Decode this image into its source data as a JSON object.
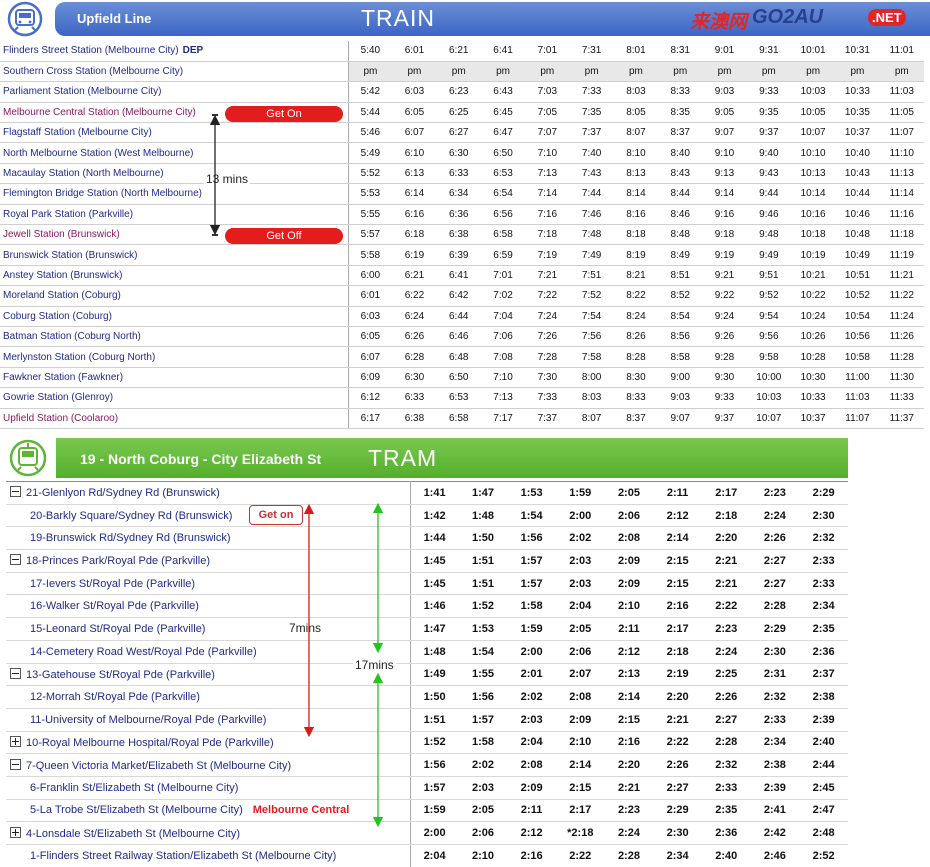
{
  "train": {
    "line_title": "Upfield Line",
    "mode_label": "TRAIN",
    "dep_label": "DEP",
    "times": [
      [
        "5:40",
        "6:01",
        "6:21",
        "6:41",
        "7:01",
        "7:31",
        "8:01",
        "8:31",
        "9:01",
        "9:31",
        "10:01",
        "10:31",
        "11:01"
      ],
      [
        "pm",
        "pm",
        "pm",
        "pm",
        "pm",
        "pm",
        "pm",
        "pm",
        "pm",
        "pm",
        "pm",
        "pm",
        "pm"
      ],
      [
        "5:42",
        "6:03",
        "6:23",
        "6:43",
        "7:03",
        "7:33",
        "8:03",
        "8:33",
        "9:03",
        "9:33",
        "10:03",
        "10:33",
        "11:03"
      ],
      [
        "5:44",
        "6:05",
        "6:25",
        "6:45",
        "7:05",
        "7:35",
        "8:05",
        "8:35",
        "9:05",
        "9:35",
        "10:05",
        "10:35",
        "11:05"
      ],
      [
        "5:46",
        "6:07",
        "6:27",
        "6:47",
        "7:07",
        "7:37",
        "8:07",
        "8:37",
        "9:07",
        "9:37",
        "10:07",
        "10:37",
        "11:07"
      ],
      [
        "5:49",
        "6:10",
        "6:30",
        "6:50",
        "7:10",
        "7:40",
        "8:10",
        "8:40",
        "9:10",
        "9:40",
        "10:10",
        "10:40",
        "11:10"
      ],
      [
        "5:52",
        "6:13",
        "6:33",
        "6:53",
        "7:13",
        "7:43",
        "8:13",
        "8:43",
        "9:13",
        "9:43",
        "10:13",
        "10:43",
        "11:13"
      ],
      [
        "5:53",
        "6:14",
        "6:34",
        "6:54",
        "7:14",
        "7:44",
        "8:14",
        "8:44",
        "9:14",
        "9:44",
        "10:14",
        "10:44",
        "11:14"
      ],
      [
        "5:55",
        "6:16",
        "6:36",
        "6:56",
        "7:16",
        "7:46",
        "8:16",
        "8:46",
        "9:16",
        "9:46",
        "10:16",
        "10:46",
        "11:16"
      ],
      [
        "5:57",
        "6:18",
        "6:38",
        "6:58",
        "7:18",
        "7:48",
        "8:18",
        "8:48",
        "9:18",
        "9:48",
        "10:18",
        "10:48",
        "11:18"
      ],
      [
        "5:58",
        "6:19",
        "6:39",
        "6:59",
        "7:19",
        "7:49",
        "8:19",
        "8:49",
        "9:19",
        "9:49",
        "10:19",
        "10:49",
        "11:19"
      ],
      [
        "6:00",
        "6:21",
        "6:41",
        "7:01",
        "7:21",
        "7:51",
        "8:21",
        "8:51",
        "9:21",
        "9:51",
        "10:21",
        "10:51",
        "11:21"
      ],
      [
        "6:01",
        "6:22",
        "6:42",
        "7:02",
        "7:22",
        "7:52",
        "8:22",
        "8:52",
        "9:22",
        "9:52",
        "10:22",
        "10:52",
        "11:22"
      ],
      [
        "6:03",
        "6:24",
        "6:44",
        "7:04",
        "7:24",
        "7:54",
        "8:24",
        "8:54",
        "9:24",
        "9:54",
        "10:24",
        "10:54",
        "11:24"
      ],
      [
        "6:05",
        "6:26",
        "6:46",
        "7:06",
        "7:26",
        "7:56",
        "8:26",
        "8:56",
        "9:26",
        "9:56",
        "10:26",
        "10:56",
        "11:26"
      ],
      [
        "6:07",
        "6:28",
        "6:48",
        "7:08",
        "7:28",
        "7:58",
        "8:28",
        "8:58",
        "9:28",
        "9:58",
        "10:28",
        "10:58",
        "11:28"
      ],
      [
        "6:09",
        "6:30",
        "6:50",
        "7:10",
        "7:30",
        "8:00",
        "8:30",
        "9:00",
        "9:30",
        "10:00",
        "10:30",
        "11:00",
        "11:30"
      ],
      [
        "6:12",
        "6:33",
        "6:53",
        "7:13",
        "7:33",
        "8:03",
        "8:33",
        "9:03",
        "9:33",
        "10:03",
        "10:33",
        "11:03",
        "11:33"
      ],
      [
        "6:17",
        "6:38",
        "6:58",
        "7:17",
        "7:37",
        "8:07",
        "8:37",
        "9:07",
        "9:37",
        "10:07",
        "10:37",
        "11:07",
        "11:37"
      ]
    ],
    "stations": [
      "Flinders Street Station (Melbourne City)",
      "Southern Cross Station (Melbourne City)",
      "Parliament Station (Melbourne City)",
      "Melbourne Central Station (Melbourne City)",
      "Flagstaff Station (Melbourne City)",
      "North Melbourne Station (West Melbourne)",
      "Macaulay Station (North Melbourne)",
      "Flemington Bridge Station (North Melbourne)",
      "Royal Park Station (Parkville)",
      "Jewell Station (Brunswick)",
      "Brunswick Station (Brunswick)",
      "Anstey Station (Brunswick)",
      "Moreland Station (Coburg)",
      "Coburg Station (Coburg)",
      "Batman Station (Coburg North)",
      "Merlynston Station (Coburg North)",
      "Fawkner Station (Fawkner)",
      "Gowrie Station (Glenroy)",
      "Upfield Station (Coolaroo)"
    ],
    "get_on_label": "Get On",
    "get_off_label": "Get Off",
    "duration_label": "13 mins"
  },
  "logo": {
    "cn": "来澳网",
    "en": "GO2AU",
    "net": ".NET"
  },
  "tram": {
    "route_title": "19 - North Coburg - City Elizabeth St",
    "mode_label": "TRAM",
    "stops": [
      "21-Glenlyon Rd/Sydney Rd (Brunswick)",
      "20-Barkly Square/Sydney Rd (Brunswick)",
      "19-Brunswick Rd/Sydney Rd (Brunswick)",
      "18-Princes Park/Royal Pde (Parkville)",
      "17-Ievers St/Royal Pde (Parkville)",
      "16-Walker St/Royal Pde (Parkville)",
      "15-Leonard St/Royal Pde (Parkville)",
      "14-Cemetery Road West/Royal Pde (Parkville)",
      "13-Gatehouse St/Royal Pde (Parkville)",
      "12-Morrah St/Royal Pde (Parkville)",
      "11-University of Melbourne/Royal Pde (Parkville)",
      "10-Royal Melbourne Hospital/Royal Pde (Parkville)",
      "7-Queen Victoria Market/Elizabeth St (Melbourne City)",
      "6-Franklin St/Elizabeth St (Melbourne City)",
      "5-La Trobe St/Elizabeth St (Melbourne City)",
      "4-Lonsdale St/Elizabeth St (Melbourne City)",
      "1-Flinders Street Railway Station/Elizabeth St (Melbourne City)"
    ],
    "times": [
      [
        "1:41",
        "1:47",
        "1:53",
        "1:59",
        "2:05",
        "2:11",
        "2:17",
        "2:23",
        "2:29"
      ],
      [
        "1:42",
        "1:48",
        "1:54",
        "2:00",
        "2:06",
        "2:12",
        "2:18",
        "2:24",
        "2:30"
      ],
      [
        "1:44",
        "1:50",
        "1:56",
        "2:02",
        "2:08",
        "2:14",
        "2:20",
        "2:26",
        "2:32"
      ],
      [
        "1:45",
        "1:51",
        "1:57",
        "2:03",
        "2:09",
        "2:15",
        "2:21",
        "2:27",
        "2:33"
      ],
      [
        "1:45",
        "1:51",
        "1:57",
        "2:03",
        "2:09",
        "2:15",
        "2:21",
        "2:27",
        "2:33"
      ],
      [
        "1:46",
        "1:52",
        "1:58",
        "2:04",
        "2:10",
        "2:16",
        "2:22",
        "2:28",
        "2:34"
      ],
      [
        "1:47",
        "1:53",
        "1:59",
        "2:05",
        "2:11",
        "2:17",
        "2:23",
        "2:29",
        "2:35"
      ],
      [
        "1:48",
        "1:54",
        "2:00",
        "2:06",
        "2:12",
        "2:18",
        "2:24",
        "2:30",
        "2:36"
      ],
      [
        "1:49",
        "1:55",
        "2:01",
        "2:07",
        "2:13",
        "2:19",
        "2:25",
        "2:31",
        "2:37"
      ],
      [
        "1:50",
        "1:56",
        "2:02",
        "2:08",
        "2:14",
        "2:20",
        "2:26",
        "2:32",
        "2:38"
      ],
      [
        "1:51",
        "1:57",
        "2:03",
        "2:09",
        "2:15",
        "2:21",
        "2:27",
        "2:33",
        "2:39"
      ],
      [
        "1:52",
        "1:58",
        "2:04",
        "2:10",
        "2:16",
        "2:22",
        "2:28",
        "2:34",
        "2:40"
      ],
      [
        "1:56",
        "2:02",
        "2:08",
        "2:14",
        "2:20",
        "2:26",
        "2:32",
        "2:38",
        "2:44"
      ],
      [
        "1:57",
        "2:03",
        "2:09",
        "2:15",
        "2:21",
        "2:27",
        "2:33",
        "2:39",
        "2:45"
      ],
      [
        "1:59",
        "2:05",
        "2:11",
        "2:17",
        "2:23",
        "2:29",
        "2:35",
        "2:41",
        "2:47"
      ],
      [
        "2:00",
        "2:06",
        "2:12",
        "*2:18",
        "2:24",
        "2:30",
        "2:36",
        "2:42",
        "2:48"
      ],
      [
        "2:04",
        "2:10",
        "2:16",
        "2:22",
        "2:28",
        "2:34",
        "2:40",
        "2:46",
        "2:52"
      ]
    ],
    "melbourne_central_label": "Melbourne Central",
    "get_on_label": "Get on",
    "duration_short_label": "7mins",
    "duration_long_label": "17mins",
    "expanders": [
      "minus",
      "none",
      "none",
      "minus",
      "none",
      "none",
      "none",
      "none",
      "minus",
      "none",
      "none",
      "plus",
      "minus",
      "none",
      "none",
      "plus",
      "none"
    ]
  },
  "colors": {
    "train_banner": "#3c66c3",
    "tram_banner": "#54ae2c",
    "callout_red": "#e31c1c",
    "station_text": "#202a8a",
    "arrow_green": "#22c422"
  },
  "icons": {
    "train": "train-icon",
    "tram": "tram-icon"
  }
}
